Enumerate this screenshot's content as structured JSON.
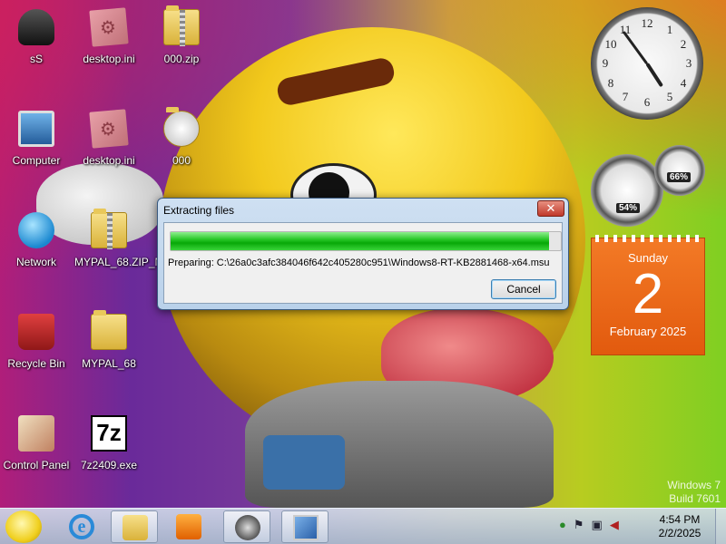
{
  "desktop_icons": [
    {
      "label": "sS",
      "icon": "user-folder-icon"
    },
    {
      "label": "desktop.ini",
      "icon": "ini-file-icon"
    },
    {
      "label": "000.zip",
      "icon": "zip-folder-icon"
    },
    {
      "label": "Computer",
      "icon": "computer-icon"
    },
    {
      "label": "desktop.ini",
      "icon": "ini-file-icon"
    },
    {
      "label": "000",
      "icon": "disc-folder-icon"
    },
    {
      "label": "Network",
      "icon": "network-icon"
    },
    {
      "label": "MYPAL_68.ZIP_N",
      "icon": "zip-folder-icon"
    },
    {
      "label": "Recycle Bin",
      "icon": "recycle-bin-icon"
    },
    {
      "label": "MYPAL_68",
      "icon": "folder-icon"
    },
    {
      "label": "Control Panel",
      "icon": "control-panel-icon"
    },
    {
      "label": "7z2409.exe",
      "icon": "7zip-icon"
    }
  ],
  "sevenz_text": "7z",
  "dialog": {
    "title": "Extracting files",
    "close_label": "✕",
    "progress": 0.97,
    "status": "Preparing: C:\\26a0c3afc384046f642c405280c951\\Windows8-RT-KB2881468-x64.msu",
    "cancel_label": "Cancel"
  },
  "gadgets": {
    "clock": {
      "numbers": [
        "12",
        "1",
        "2",
        "3",
        "4",
        "5",
        "6",
        "7",
        "8",
        "9",
        "10",
        "11"
      ],
      "hour": 4,
      "minute": 54
    },
    "cpu_meter": {
      "cpu": "54%",
      "memory": "66%"
    },
    "calendar": {
      "day_of_week": "Sunday",
      "day": "2",
      "month_year": "February 2025"
    }
  },
  "watermark": {
    "line1": "Windows 7",
    "line2": "Build 7601"
  },
  "taskbar": {
    "items": [
      {
        "name": "internet-explorer",
        "icon": "ie-icon",
        "active": false
      },
      {
        "name": "libraries",
        "icon": "libraries-icon",
        "active": true
      },
      {
        "name": "media-player",
        "icon": "media-player-icon",
        "active": false
      },
      {
        "name": "raccoon-app",
        "icon": "raccoon-icon",
        "active": true
      },
      {
        "name": "setup",
        "icon": "setup-icon",
        "active": true
      }
    ],
    "tray_icons": [
      "security-icon",
      "flag-icon",
      "network-tray-icon",
      "volume-muted-icon"
    ],
    "time": "4:54 PM",
    "date": "2/2/2025",
    "ie_glyph": "e"
  },
  "colors": {
    "calendar_bg": "#f07020",
    "progress_green": "#18b818",
    "dialog_border": "#3a5a80"
  }
}
